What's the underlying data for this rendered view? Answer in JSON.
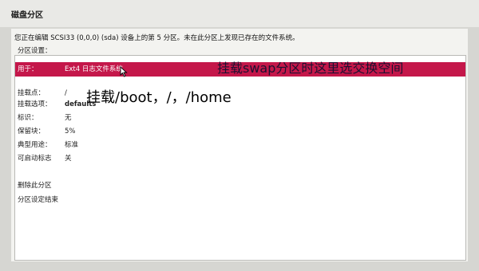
{
  "dialog": {
    "title": "磁盘分区"
  },
  "panel": {
    "description": "您正在编辑 SCSI33 (0,0,0) (sda) 设备上的第 5 分区。未在此分区上发现已存在的文件系统。",
    "section_label": "分区设置："
  },
  "settings": [
    {
      "label": "用于：",
      "value": "Ext4 日志文件系统"
    },
    {
      "label": "挂载点：",
      "value": "/"
    },
    {
      "label": "挂载选项：",
      "value": "defaults"
    },
    {
      "label": "标识：",
      "value": "无"
    },
    {
      "label": "保留块：",
      "value": "5%"
    },
    {
      "label": "典型用途：",
      "value": "标准"
    },
    {
      "label": "可启动标志",
      "value": "关"
    }
  ],
  "actions": [
    {
      "label": "删除此分区"
    },
    {
      "label": "分区设定结束"
    }
  ],
  "annotations": {
    "swap_hint": "挂载swap分区时这里选交换空间",
    "mount_hint": "挂载/boot，/，/home"
  },
  "colors": {
    "selection": "#c4174a",
    "background": "#d6d6d2"
  }
}
